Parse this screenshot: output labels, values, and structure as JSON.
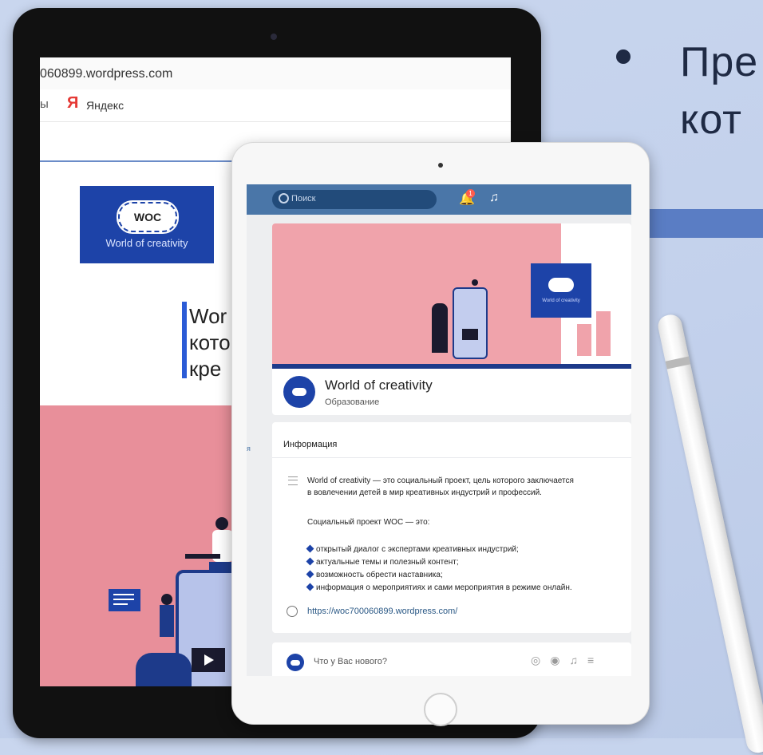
{
  "slide": {
    "text": "Пре\nкот"
  },
  "back_tablet": {
    "url": "060899.wordpress.com",
    "bookmarks_fragment": "ы",
    "yandex_logo": "Я",
    "yandex_label": "Яндекс",
    "logo_mark": "WOC",
    "logo_caption": "World of creativity",
    "headline": "Wor\nкото\nкре"
  },
  "front_tablet": {
    "search_placeholder": "Поиск",
    "notification_count": "1",
    "group": {
      "name": "World of creativity",
      "category": "Образование",
      "cover_logo_caption": "World of creativity"
    },
    "side_fragment": "я",
    "info": {
      "title": "Информация",
      "paragraph": "World of creativity — это социальный проект, цель которого заключается\nв вовлечении детей в мир креативных индустрий и профессий.",
      "intro": "Социальный проект WOC — это:",
      "items": [
        "открытый диалог с экспертами креативных индустрий;",
        "актуальные темы и полезный контент;",
        "возможность обрести наставника;",
        "информация о мероприятиях и сами мероприятия в режиме онлайн."
      ],
      "website": "https://woc700060899.wordpress.com/"
    },
    "post_prompt": "Что у Вас нового?",
    "post_icons": [
      "camera-icon",
      "video-icon",
      "music-icon",
      "text-format-icon"
    ]
  },
  "colors": {
    "background": "#c6d3ed",
    "vk_header": "#4a76a8",
    "brand_blue": "#1d43a8",
    "cover_pink": "#f0a3ab",
    "slide_accent": "#5a7dc4"
  }
}
